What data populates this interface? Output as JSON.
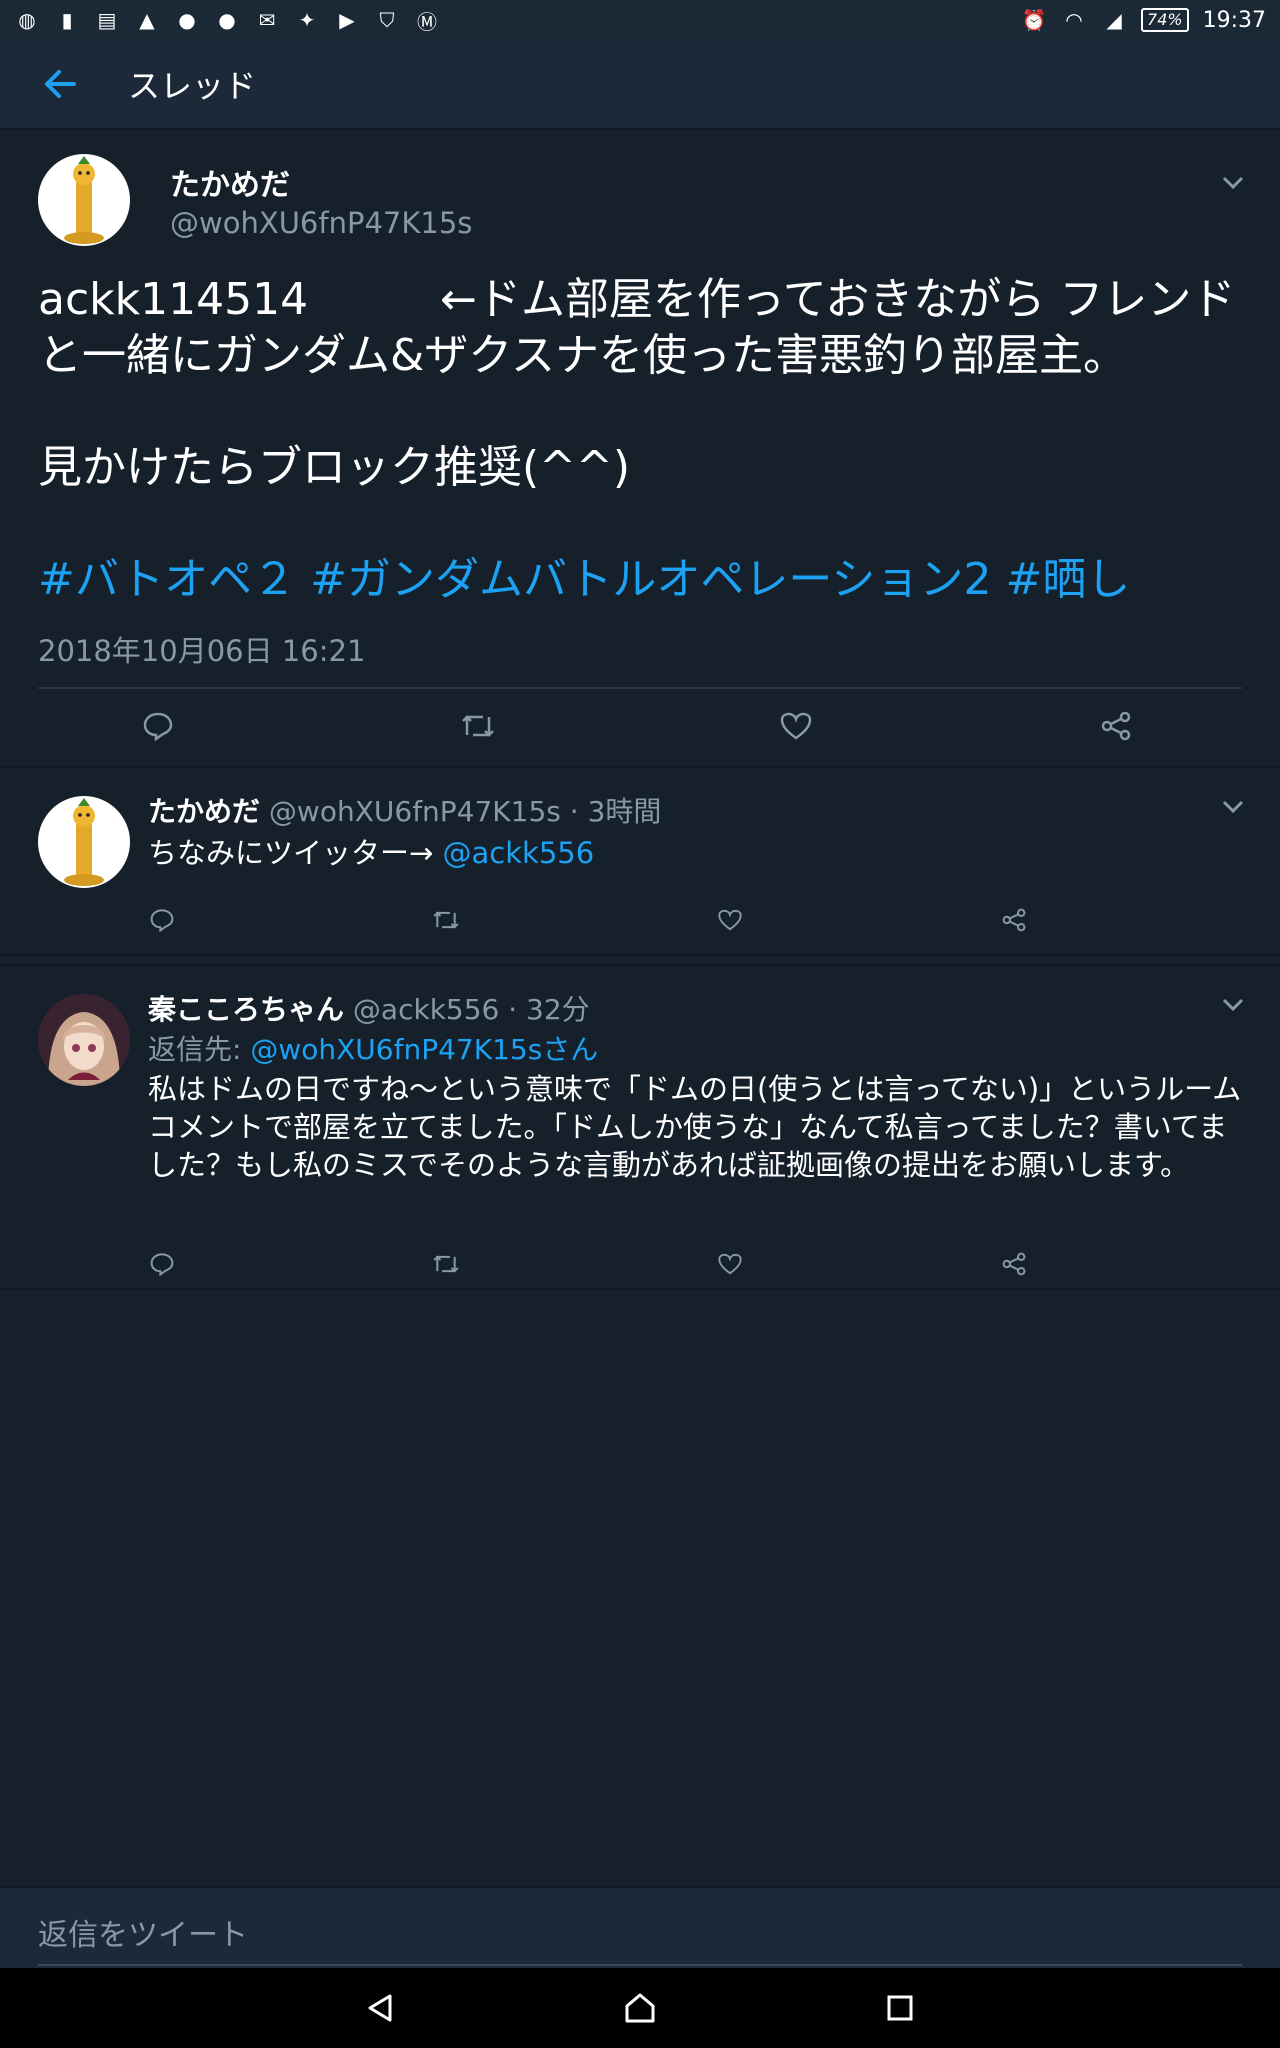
{
  "status_bar": {
    "battery": "74%",
    "time": "19:37"
  },
  "app_bar": {
    "title": "スレッド"
  },
  "main_tweet": {
    "display_name": "たかめだ",
    "handle": "@wohXU6fnP47K15s",
    "text": "ackk114514　　　←ドム部屋を作っておきながら フレンドと一緒にガンダム&ザクスナを使った害悪釣り部屋主。\n\n見かけたらブロック推奨(^^)\n\n",
    "hashtags": "#バトオペ２ #ガンダムバトルオペレーション2 #晒し",
    "timestamp": "2018年10月06日 16:21"
  },
  "replies": [
    {
      "display_name": "たかめだ",
      "meta": "@wohXU6fnP47K15s · 3時間",
      "text": "ちなみにツイッター→ ",
      "mention": "@ackk556"
    },
    {
      "display_name": "秦こころちゃん",
      "meta": "@ackk556 · 32分",
      "reply_to_label": "返信先: ",
      "reply_to": "@wohXU6fnP47K15sさん",
      "text": "私はドムの日ですね〜という意味で「ドムの日(使うとは言ってない)」というルームコメントで部屋を立てました。「ドムしか使うな」なんて私言ってました？書いてました？もし私のミスでそのような言動があれば証拠画像の提出をお願いします。"
    }
  ],
  "reply_input": {
    "placeholder": "返信をツイート"
  },
  "colors": {
    "background": "#15202b",
    "accent": "#1da1f2",
    "muted": "#8899a6"
  }
}
